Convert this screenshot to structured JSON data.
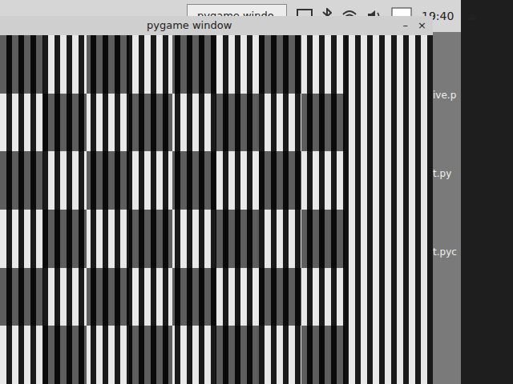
{
  "taskbar": {
    "tasks": [
      {
        "label": "pygame windo",
        "selected": true
      }
    ],
    "clock": "19:40",
    "eject": "⏏"
  },
  "window": {
    "title": "pygame window",
    "minimize": "–",
    "close": "×"
  },
  "pattern": {
    "rows": [
      [
        true,
        false,
        true,
        false,
        true,
        false,
        true,
        false
      ],
      [
        false,
        true,
        false,
        true,
        false,
        true,
        false,
        true
      ],
      [
        true,
        false,
        true,
        false,
        true,
        false,
        true,
        false
      ],
      [
        false,
        true,
        false,
        true,
        false,
        true,
        false,
        true
      ],
      [
        true,
        false,
        true,
        false,
        true,
        false,
        true,
        false
      ],
      [
        false,
        true,
        false,
        true,
        false,
        true,
        false,
        true
      ]
    ]
  },
  "desktop": {
    "files": [
      "ive.p",
      "t.py",
      "t.pyc"
    ]
  }
}
